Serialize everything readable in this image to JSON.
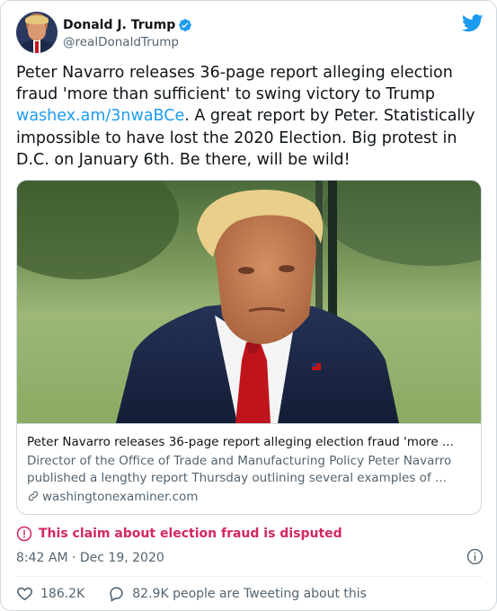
{
  "author": {
    "name": "Donald J. Trump",
    "handle": "@realDonaldTrump",
    "verified": true
  },
  "tweet": {
    "text_before": "Peter Navarro releases 36-page report alleging election fraud 'more than sufficient' to swing victory to Trump ",
    "link": "washex.am/3nwaBCe",
    "text_after": ". A great report by Peter. Statistically impossible to have lost the 2020 Election. Big protest in D.C. on January 6th. Be there, will be wild!"
  },
  "link_card": {
    "title": "Peter Navarro releases 36-page report alleging election fraud 'more ...",
    "description": "Director of the Office of Trade and Manufacturing Policy Peter Navarro published a lengthy report Thursday outlining several examples of ...",
    "domain": "washingtonexaminer.com"
  },
  "label": {
    "text": "This claim about election fraud is disputed",
    "color": "#d4275f"
  },
  "timestamp": "8:42 AM · Dec 19, 2020",
  "actions": {
    "likes": "186.2K",
    "tweeting": "82.9K people are Tweeting about this"
  },
  "icons": {
    "twitter": "twitter-bird-icon",
    "verified": "verified-badge-icon",
    "alert": "exclamation-circle-icon",
    "info": "info-icon",
    "like": "heart-icon",
    "reply": "speech-bubble-icon",
    "link": "link-chain-icon"
  },
  "colors": {
    "accent": "#1d9bf0",
    "text": "#0f1419",
    "secondary": "#536471",
    "border": "#cfd9de"
  }
}
